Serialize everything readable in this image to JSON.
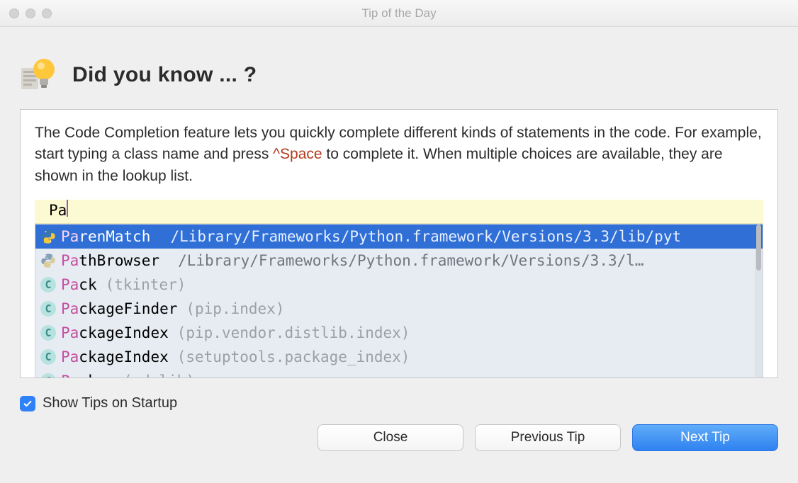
{
  "window": {
    "title": "Tip of the Day"
  },
  "heading": "Did you know ... ?",
  "tip": {
    "text_before": "The Code Completion feature lets you quickly complete different kinds of statements in the code. For example, start typing a class name and press ",
    "shortcut": "^Space",
    "text_after": " to complete it. When multiple choices are available, they are shown in the lookup list."
  },
  "editor": {
    "typed_prefix": "Pa",
    "items": [
      {
        "icon": "python-icon",
        "match": "Pa",
        "rest": "renMatch",
        "path": "/Library/Frameworks/Python.framework/Versions/3.3/lib/pyt",
        "selected": true
      },
      {
        "icon": "python-icon",
        "match": "Pa",
        "rest": "thBrowser",
        "path": "/Library/Frameworks/Python.framework/Versions/3.3/l…",
        "selected": false
      },
      {
        "icon": "class-icon",
        "match": "Pa",
        "rest": "ck",
        "meta": "(tkinter)"
      },
      {
        "icon": "class-icon",
        "match": "Pa",
        "rest": "ckageFinder",
        "meta": "(pip.index)"
      },
      {
        "icon": "class-icon",
        "match": "Pa",
        "rest": "ckageIndex",
        "meta": "(pip.vendor.distlib.index)"
      },
      {
        "icon": "class-icon",
        "match": "Pa",
        "rest": "ckageIndex",
        "meta": "(setuptools.package_index)"
      },
      {
        "icon": "class-icon",
        "match": "Pa",
        "rest": "cker",
        "meta": "(xdrlib)"
      }
    ]
  },
  "checkbox": {
    "label": "Show Tips on Startup",
    "checked": true
  },
  "buttons": {
    "close": "Close",
    "prev": "Previous Tip",
    "next": "Next Tip"
  },
  "colors": {
    "accent": "#2f81f7",
    "shortcut": "#b23b1d",
    "highlight": "#c64ea0"
  }
}
